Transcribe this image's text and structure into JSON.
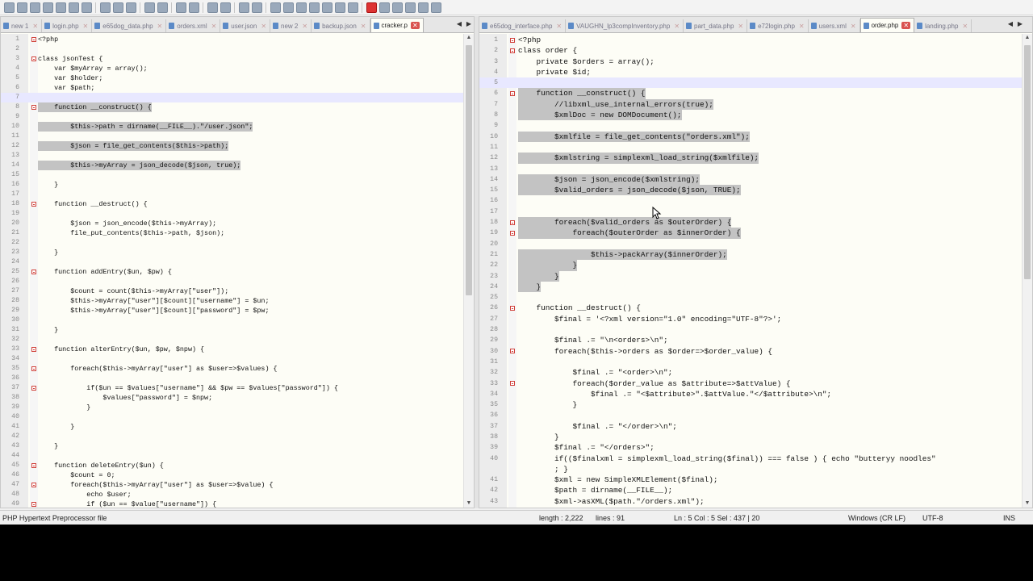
{
  "left_tabs": [
    {
      "label": "new 1"
    },
    {
      "label": "login.php"
    },
    {
      "label": "e65dog_data.php"
    },
    {
      "label": "orders.xml"
    },
    {
      "label": "user.json"
    },
    {
      "label": "new 2"
    },
    {
      "label": "backup.json"
    },
    {
      "label": "cracker.p",
      "active": true
    }
  ],
  "right_tabs": [
    {
      "label": "e65dog_interface.php"
    },
    {
      "label": "VAUGHN_lp3compInventory.php"
    },
    {
      "label": "part_data.php"
    },
    {
      "label": "e72login.php"
    },
    {
      "label": "users.xml"
    },
    {
      "label": "order.php",
      "active": true
    },
    {
      "label": "landing.php"
    }
  ],
  "left_lines": [
    {
      "n": "1",
      "t": "<?php",
      "f": true
    },
    {
      "n": "2",
      "t": ""
    },
    {
      "n": "3",
      "t": "class jsonTest {",
      "f": true
    },
    {
      "n": "4",
      "t": "    var $myArray = array();"
    },
    {
      "n": "5",
      "t": "    var $holder;"
    },
    {
      "n": "6",
      "t": "    var $path;"
    },
    {
      "n": "7",
      "t": "",
      "cur": true
    },
    {
      "n": "8",
      "t": "    function __construct() {",
      "f": true,
      "sel": true
    },
    {
      "n": "9",
      "t": "",
      "sel": true
    },
    {
      "n": "10",
      "t": "        $this->path = dirname(__FILE__).\"/user.json\";",
      "sel": true
    },
    {
      "n": "11",
      "t": "",
      "sel": true
    },
    {
      "n": "12",
      "t": "        $json = file_get_contents($this->path);",
      "sel": true
    },
    {
      "n": "13",
      "t": "",
      "sel": true
    },
    {
      "n": "14",
      "t": "        $this->myArray = json_decode($json, true);",
      "sel": true
    },
    {
      "n": "15",
      "t": "",
      "sel": true
    },
    {
      "n": "16",
      "t": "    }"
    },
    {
      "n": "17",
      "t": ""
    },
    {
      "n": "18",
      "t": "    function __destruct() {",
      "f": true
    },
    {
      "n": "19",
      "t": ""
    },
    {
      "n": "20",
      "t": "        $json = json_encode($this->myArray);"
    },
    {
      "n": "21",
      "t": "        file_put_contents($this->path, $json);"
    },
    {
      "n": "22",
      "t": ""
    },
    {
      "n": "23",
      "t": "    }"
    },
    {
      "n": "24",
      "t": ""
    },
    {
      "n": "25",
      "t": "    function addEntry($un, $pw) {",
      "f": true
    },
    {
      "n": "26",
      "t": ""
    },
    {
      "n": "27",
      "t": "        $count = count($this->myArray[\"user\"]);"
    },
    {
      "n": "28",
      "t": "        $this->myArray[\"user\"][$count][\"username\"] = $un;"
    },
    {
      "n": "29",
      "t": "        $this->myArray[\"user\"][$count][\"password\"] = $pw;"
    },
    {
      "n": "30",
      "t": ""
    },
    {
      "n": "31",
      "t": "    }"
    },
    {
      "n": "32",
      "t": ""
    },
    {
      "n": "33",
      "t": "    function alterEntry($un, $pw, $npw) {",
      "f": true
    },
    {
      "n": "34",
      "t": ""
    },
    {
      "n": "35",
      "t": "        foreach($this->myArray[\"user\"] as $user=>$values) {",
      "f": true
    },
    {
      "n": "36",
      "t": ""
    },
    {
      "n": "37",
      "t": "            if($un == $values[\"username\"] && $pw == $values[\"password\"]) {",
      "f": true
    },
    {
      "n": "38",
      "t": "                $values[\"password\"] = $npw;"
    },
    {
      "n": "39",
      "t": "            }"
    },
    {
      "n": "40",
      "t": ""
    },
    {
      "n": "41",
      "t": "        }"
    },
    {
      "n": "42",
      "t": ""
    },
    {
      "n": "43",
      "t": "    }"
    },
    {
      "n": "44",
      "t": ""
    },
    {
      "n": "45",
      "t": "    function deleteEntry($un) {",
      "f": true
    },
    {
      "n": "46",
      "t": "        $count = 0;"
    },
    {
      "n": "47",
      "t": "        foreach($this->myArray[\"user\"] as $user=>$value) {",
      "f": true
    },
    {
      "n": "48",
      "t": "            echo $user;"
    },
    {
      "n": "49",
      "t": "            if ($un == $value[\"username\"]) {",
      "f": true
    }
  ],
  "right_lines": [
    {
      "n": "1",
      "t": "<?php",
      "f": true
    },
    {
      "n": "2",
      "t": "class order {",
      "f": true
    },
    {
      "n": "3",
      "t": "    private $orders = array();"
    },
    {
      "n": "4",
      "t": "    private $id;"
    },
    {
      "n": "5",
      "t": "",
      "cur": true
    },
    {
      "n": "6",
      "t": "    function __construct() {",
      "f": true,
      "sel": true
    },
    {
      "n": "7",
      "t": "        //libxml_use_internal_errors(true);",
      "sel": true
    },
    {
      "n": "8",
      "t": "        $xmlDoc = new DOMDocument();",
      "sel": true
    },
    {
      "n": "9",
      "t": "",
      "sel": true
    },
    {
      "n": "10",
      "t": "        $xmlfile = file_get_contents(\"orders.xml\");",
      "sel": true
    },
    {
      "n": "11",
      "t": "",
      "sel": true
    },
    {
      "n": "12",
      "t": "        $xmlstring = simplexml_load_string($xmlfile);",
      "sel": true
    },
    {
      "n": "13",
      "t": "",
      "sel": true
    },
    {
      "n": "14",
      "t": "        $json = json_encode($xmlstring);",
      "sel": true
    },
    {
      "n": "15",
      "t": "        $valid_orders = json_decode($json, TRUE);",
      "sel": true
    },
    {
      "n": "16",
      "t": "",
      "sel": true
    },
    {
      "n": "17",
      "t": "",
      "sel": true
    },
    {
      "n": "18",
      "t": "        foreach($valid_orders as $outerOrder) {",
      "f": true,
      "sel": true
    },
    {
      "n": "19",
      "t": "            foreach($outerOrder as $innerOrder) {",
      "f": true,
      "sel": true
    },
    {
      "n": "20",
      "t": "",
      "sel": true
    },
    {
      "n": "21",
      "t": "                $this->packArray($innerOrder);",
      "sel": true
    },
    {
      "n": "22",
      "t": "            }",
      "sel": true
    },
    {
      "n": "23",
      "t": "        }",
      "sel": true
    },
    {
      "n": "24",
      "t": "    }",
      "sel": true
    },
    {
      "n": "25",
      "t": ""
    },
    {
      "n": "26",
      "t": "    function __destruct() {",
      "f": true
    },
    {
      "n": "27",
      "t": "        $final = '<?xml version=\"1.0\" encoding=\"UTF-8\"?>';"
    },
    {
      "n": "28",
      "t": ""
    },
    {
      "n": "29",
      "t": "        $final .= \"\\n<orders>\\n\";"
    },
    {
      "n": "30",
      "t": "        foreach($this->orders as $order=>$order_value) {",
      "f": true
    },
    {
      "n": "31",
      "t": ""
    },
    {
      "n": "32",
      "t": "            $final .= \"<order>\\n\";"
    },
    {
      "n": "33",
      "t": "            foreach($order_value as $attribute=>$attValue) {",
      "f": true
    },
    {
      "n": "34",
      "t": "                $final .= \"<$attribute>\".$attValue.\"</$attribute>\\n\";"
    },
    {
      "n": "35",
      "t": "            }"
    },
    {
      "n": "36",
      "t": ""
    },
    {
      "n": "37",
      "t": "            $final .= \"</order>\\n\";"
    },
    {
      "n": "38",
      "t": "        }"
    },
    {
      "n": "39",
      "t": "        $final .= \"</orders>\";"
    },
    {
      "n": "40",
      "t": "        if(($finalxml = simplexml_load_string($final)) === false ) { echo \"butteryy noodles\""
    },
    {
      "n": "",
      "t": "        ; }"
    },
    {
      "n": "41",
      "t": "        $xml = new SimpleXMLElement($final);"
    },
    {
      "n": "42",
      "t": "        $path = dirname(__FILE__);"
    },
    {
      "n": "43",
      "t": "        $xml->asXML($path.\"/orders.xml\");"
    }
  ],
  "status": {
    "file_type": "PHP Hypertext Preprocessor file",
    "length": "length : 2,222",
    "lines": "lines : 91",
    "position": "Ln : 5    Col : 5    Sel : 437 | 20",
    "eol": "Windows (CR LF)",
    "encoding": "UTF-8",
    "mode": "INS"
  },
  "icons": {
    "toolbar": [
      "new-file-icon",
      "open-file-icon",
      "save-icon",
      "save-all-icon",
      "close-icon",
      "close-all-icon",
      "print-icon",
      "cut-icon",
      "copy-icon",
      "paste-icon",
      "undo-icon",
      "redo-icon",
      "find-icon",
      "replace-icon",
      "zoom-in-icon",
      "zoom-out-icon",
      "sync-vertical-icon",
      "sync-horizontal-icon",
      "word-wrap-icon",
      "show-all-chars-icon",
      "indent-guide-icon",
      "doc-map-icon",
      "function-list-icon",
      "folder-workspace-icon",
      "monitoring-icon",
      "record-macro-icon",
      "stop-macro-icon",
      "play-macro-icon",
      "run-macro-multiple-icon",
      "save-macro-icon",
      "spellcheck-icon"
    ]
  },
  "colors": {
    "fold_marker": "#d0413b",
    "selection": "#c3c3c3",
    "current_line": "#e8e8ff",
    "active_tab_close": "#d9534f"
  }
}
